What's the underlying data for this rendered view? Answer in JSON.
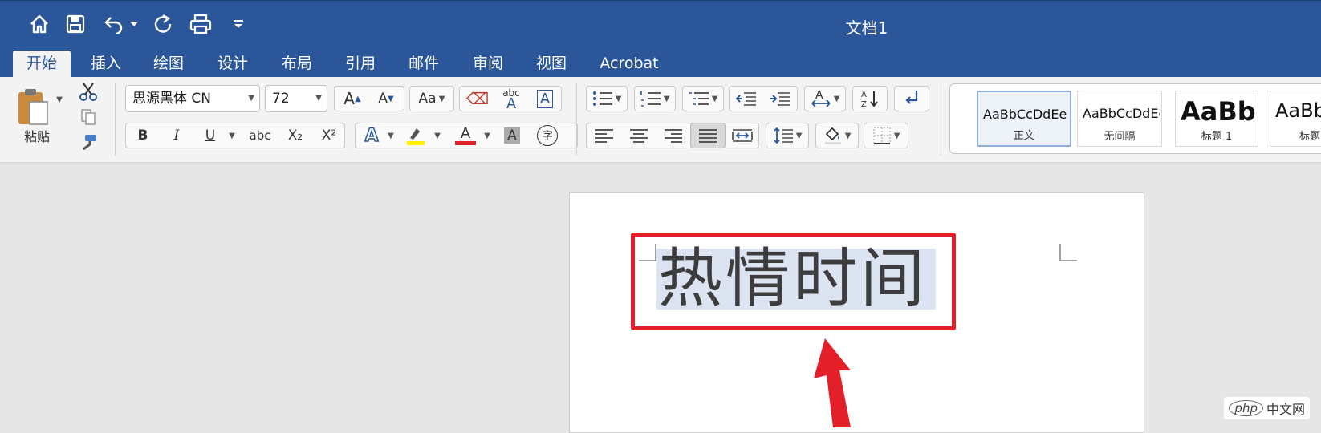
{
  "window": {
    "title": "文档1"
  },
  "tabs": [
    "开始",
    "插入",
    "绘图",
    "设计",
    "布局",
    "引用",
    "邮件",
    "审阅",
    "视图",
    "Acrobat"
  ],
  "active_tab": "开始",
  "clipboard": {
    "paste_label": "粘贴"
  },
  "font": {
    "family": "思源黑体 CN",
    "size": "72"
  },
  "format": {
    "bold": "B",
    "italic": "I",
    "underline": "U",
    "strike": "abc",
    "subscript": "X₂",
    "superscript": "X²",
    "grow": "A",
    "shrink": "A",
    "case": "Aa",
    "phonetic": "abc",
    "textbox": "A",
    "highlight": "A",
    "font_color": "A",
    "shading": "A",
    "enclose": "字"
  },
  "styles": [
    {
      "sample": "AaBbCcDdEe",
      "name": "正文"
    },
    {
      "sample": "AaBbCcDdEe",
      "name": "无间隔"
    },
    {
      "sample": "AaBb(",
      "name": "标题 1"
    },
    {
      "sample": "AaBb",
      "name": "标题"
    }
  ],
  "document": {
    "text": "热情时间"
  },
  "watermark": {
    "logo": "php",
    "text": "中文网"
  },
  "colors": {
    "accent": "#2b579a",
    "highlight": "#ffee00",
    "font_red": "#e3202a",
    "annotation": "#e3202a"
  }
}
